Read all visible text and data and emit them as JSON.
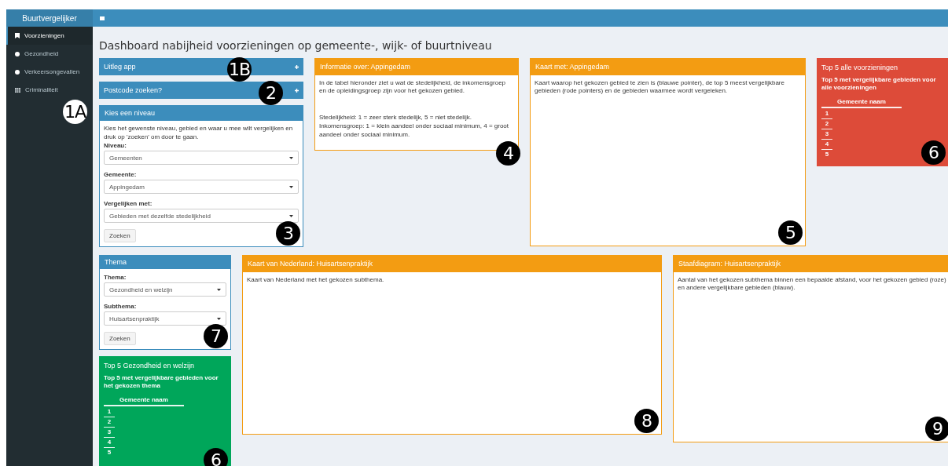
{
  "app": {
    "title": "Buurtvergelijker"
  },
  "sidebar": {
    "items": [
      {
        "label": "Voorzieningen",
        "selected": true
      },
      {
        "label": "Gezondheid",
        "selected": false
      },
      {
        "label": "Verkeersongevallen",
        "selected": false
      },
      {
        "label": "Criminaliteit",
        "selected": false
      }
    ],
    "callout": {
      "text": "1A",
      "kind": "light"
    }
  },
  "page_title": "Dashboard nabijheid voorzieningen op gemeente-, wijk- of buurtniveau",
  "rows": [
    {
      "left_column": [
        {
          "kind": "collapsible",
          "title": "Uitleg app",
          "color": "#3c8dbc",
          "callout": {
            "text": "1B",
            "kind": "dark"
          }
        },
        {
          "kind": "collapsible",
          "title": "Postcode zoeken?",
          "color": "#3c8dbc",
          "callout": {
            "text": "2",
            "kind": "dark"
          }
        },
        {
          "kind": "form",
          "title": "Kies een niveau",
          "color": "#3c8dbc",
          "intro": "Kies het gewenste niveau, gebied en waar u mee wilt vergelijken en druk op 'zoeken' om door te gaan.",
          "fields": [
            {
              "label": "Niveau:",
              "value": "Gemeenten"
            },
            {
              "label": "Gemeente:",
              "value": "Appingedam"
            },
            {
              "label": "Vergelijken met:",
              "value": "Gebieden met dezelfde stedelijkheid"
            }
          ],
          "button": "Zoeken",
          "callout": {
            "text": "3",
            "kind": "dark"
          }
        }
      ],
      "panels": [
        {
          "kind": "info",
          "title": "Informatie over: Appingedam",
          "color": "#f39c12",
          "paragraphs": [
            "In de tabel hieronder ziet u wat de stedelijkheid, de inkomensgroep en de opleidingsgroep zijn voor het gekozen gebied.",
            "Stedelijkheid: 1 = zeer sterk stedelijk, 5 = niet stedelijk.",
            "Inkomensgroep: 1 = klein aandeel onder sociaal minimum, 4 = groot aandeel onder sociaal minimum."
          ],
          "callout": {
            "text": "4",
            "kind": "dark"
          }
        },
        {
          "kind": "info",
          "title": "Kaart met: Appingedam",
          "color": "#f39c12",
          "paragraphs": [
            "Kaart waarop het gekozen gebied te zien is (blauwe pointer), de top 5 meest vergelijkbare gebieden (rode pointers) en de gebieden waarmee wordt vergeleken."
          ],
          "callout": {
            "text": "5",
            "kind": "dark"
          }
        },
        {
          "kind": "solid",
          "title": "Top 5 alle voorzieningen",
          "color": "#dd4b39",
          "subtitle": "Top 5 met vergelijkbare gebieden voor alle voorzieningen",
          "column": "Gemeente naam",
          "ranks": [
            "1",
            "2",
            "3",
            "4",
            "5"
          ],
          "callout": {
            "text": "6",
            "kind": "dark"
          }
        }
      ]
    },
    {
      "left_column": [
        {
          "kind": "form",
          "title": "Thema",
          "color": "#3c8dbc",
          "fields": [
            {
              "label": "Thema:",
              "value": "Gezondheid en welzijn"
            },
            {
              "label": "Subthema:",
              "value": "Huisartsenpraktijk"
            }
          ],
          "button": "Zoeken",
          "callout": {
            "text": "7",
            "kind": "dark"
          }
        },
        {
          "kind": "solid",
          "title": "Top 5 Gezondheid en welzijn",
          "color": "#00a65a",
          "subtitle": "Top 5 met vergelijkbare gebieden voor het gekozen thema",
          "column": "Gemeente naam",
          "ranks": [
            "1",
            "2",
            "3",
            "4",
            "5"
          ],
          "callout": {
            "text": "6",
            "kind": "dark"
          }
        }
      ],
      "panels": [
        {
          "kind": "info",
          "title": "Kaart van Nederland: Huisartsenpraktijk",
          "color": "#f39c12",
          "paragraphs": [
            "Kaart van Nederland met het gekozen subthema."
          ],
          "callout": {
            "text": "8",
            "kind": "dark"
          }
        },
        {
          "kind": "info",
          "title": "Staafdiagram: Huisartsenpraktijk",
          "color": "#f39c12",
          "paragraphs": [
            "Aantal van het gekozen subthema binnen een bepaalde afstand, voor het gekozen gebied (roze) en andere vergelijkbare gebieden (blauw)."
          ],
          "callout": {
            "text": "9",
            "kind": "dark"
          }
        }
      ]
    }
  ]
}
